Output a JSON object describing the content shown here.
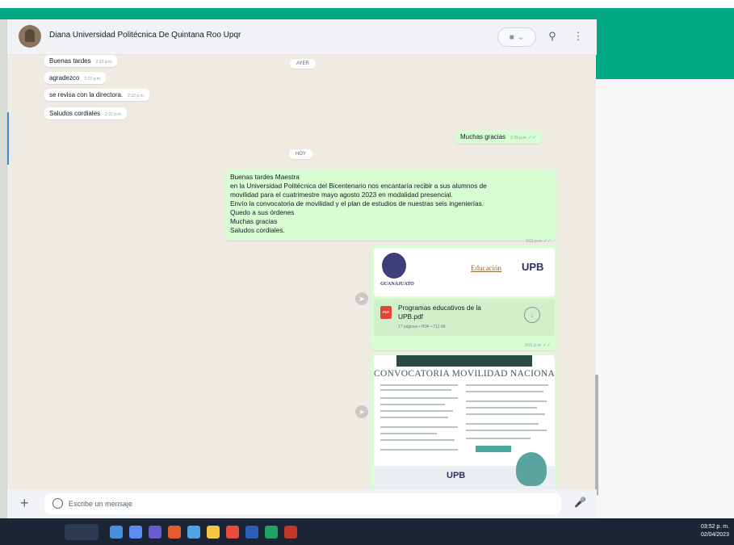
{
  "colors": {
    "accent": "#00a884",
    "outgoing_bubble": "#d9fdd3",
    "incoming_bubble": "#ffffff",
    "taskbar": "#1c2536"
  },
  "header": {
    "contact_name": "Diana Universidad Politécnica De Quintana Roo Upqr",
    "video_icon": "video-camera-icon",
    "search_icon": "search-icon",
    "menu_icon": "more-vertical-icon"
  },
  "messages": {
    "incoming": [
      {
        "text": "Buenas tardes",
        "time": "2:22 p.m."
      },
      {
        "text": "agradezco",
        "time": "2:22 p.m."
      },
      {
        "text": "se revisa con la directora.",
        "time": "2:22 p.m."
      },
      {
        "text": "Saludos cordiales",
        "time": "2:22 p.m."
      }
    ],
    "date_ayer": "AYER",
    "outgoing_thanks": {
      "text": "Muchas gracias",
      "time": "2:29 p.m."
    },
    "date_hoy": "HOY",
    "long_message": {
      "lines": [
        "Buenas tardes Maestra",
        "en la Universidad Politécnica del Bicentenario nos encantaría recibir a sus alumnos de",
        "movilidad para el cuatrimestre mayo agosto 2023 en modalidad presencial.",
        " Envío la convocatoria de movilidad y el plan de estudios de nuestras seis ingenierías.",
        "Quedo a sus órdenes",
        "Muchas gracias",
        "Saludos cordiales."
      ],
      "time": "3:01 p.m."
    },
    "document": {
      "preview_logo_text": "GUANAJUATO",
      "preview_edu": "Educación",
      "preview_upb": "UPB",
      "name": "Programas educativos de la UPB.pdf",
      "meta": "17 páginas • PDF • 711 kB",
      "time": "3:01 p.m."
    },
    "image": {
      "banner": "CONVOCATORIA MOVILIDAD NACIONAL",
      "footer_logo": "UPB"
    }
  },
  "composer": {
    "placeholder": "Escribe un mensaje",
    "plus_icon": "plus-icon",
    "emoji_icon": "emoji-icon",
    "mic_icon": "microphone-icon"
  },
  "taskbar": {
    "time": "03:52 p. m.",
    "date": "02/04/2023"
  }
}
